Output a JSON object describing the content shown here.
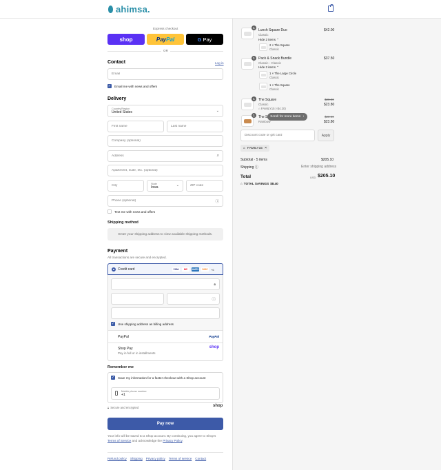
{
  "header": {
    "brand": "ahimsa."
  },
  "express": {
    "label": "Express checkout",
    "shop_pay": "shop",
    "paypal_pay": "Pay",
    "paypal_pal": "Pal",
    "gpay_g": "G",
    "gpay_pay": "Pay",
    "or": "OR"
  },
  "contact": {
    "title": "Contact",
    "login": "Log in",
    "email_placeholder": "Email",
    "news_label": "Email me with news and offers"
  },
  "delivery": {
    "title": "Delivery",
    "country_label": "Country/Region",
    "country_value": "United States",
    "first_name": "First name",
    "last_name": "Last name",
    "company": "Company (optional)",
    "address": "Address",
    "apartment": "Apartment, suite, etc. (optional)",
    "city": "City",
    "state_label": "State",
    "state_value": "Iowa",
    "zip": "ZIP code",
    "phone": "Phone (optional)",
    "text_label": "Text me with news and offers"
  },
  "shipping": {
    "title": "Shipping method",
    "info": "Enter your shipping address to view available shipping methods."
  },
  "payment": {
    "title": "Payment",
    "subtitle": "All transactions are secure and encrypted.",
    "credit_card": "Credit card",
    "cards": [
      "VISA",
      "MC",
      "AMEX",
      "DISC"
    ],
    "more_cards": "+6",
    "billing_label": "Use shipping address as billing address",
    "paypal": "PayPal",
    "paypal_logo": "PayPal",
    "shop_pay": "Shop Pay",
    "shop_pay_sub": "Pay in full or in installments",
    "shop_logo": "shop"
  },
  "remember": {
    "title": "Remember me",
    "save_label": "Save my information for a faster checkout with a Shop account",
    "mobile_label": "Mobile phone number",
    "mobile_value": "+1",
    "secure": "Secure and encrypted",
    "shop_logo": "shop"
  },
  "pay_button": "Pay now",
  "legal": {
    "text": "Your info will be saved to a Shop account. By continuing, you agree to Shop's",
    "terms": "Terms of Service",
    "and": "and acknowledge the",
    "privacy": "Privacy Policy",
    "end": "."
  },
  "footer_links": [
    "Refund policy",
    "Shipping",
    "Privacy policy",
    "Terms of service",
    "Contact"
  ],
  "cart": {
    "items": [
      {
        "qty": "1",
        "name": "Lunch Square Duo",
        "variant": "Classic",
        "price": "$42.00",
        "toggle": "Hide 2 items",
        "sub": [
          {
            "name": "2 × The Square",
            "variant": "Classic"
          }
        ]
      },
      {
        "qty": "1",
        "name": "Pack & Snack Bundle",
        "variant": "Classic - Classic",
        "price": "$37.50",
        "toggle": "Hide 2 items",
        "sub": [
          {
            "name": "1 × The Large Circle",
            "variant": "Classic"
          },
          {
            "name": "1 × The Square",
            "variant": "Classic"
          }
        ]
      },
      {
        "qty": "1",
        "name": "The Square",
        "variant": "Classic",
        "discount": "FAMILY15 (-$4.20)",
        "old_price": "$28.00",
        "price": "$23.80"
      },
      {
        "qty": "1",
        "name": "The Square",
        "variant": "Rainbow",
        "old_price": "$28.00",
        "price": "$23.80"
      }
    ],
    "scroll_tip": "Scroll for more items",
    "discount_placeholder": "Discount code or gift card",
    "apply": "Apply",
    "code_tag": "FAMILY15",
    "subtotal_label": "Subtotal · 5 items",
    "subtotal_value": "$205.10",
    "shipping_label": "Shipping",
    "shipping_value": "Enter shipping address",
    "total_label": "Total",
    "currency": "USD",
    "total_value": "$205.10",
    "savings_label": "TOTAL SAVINGS",
    "savings_value": "$8.40"
  }
}
